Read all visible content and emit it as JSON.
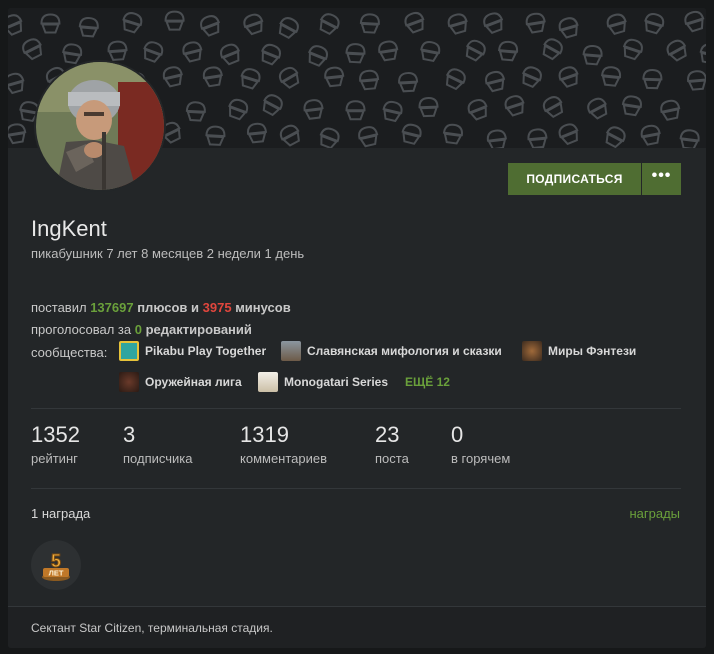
{
  "profile": {
    "username": "IngKent",
    "tenure": "пикабушник 7 лет 8 месяцев 2 недели 1 день",
    "subscribe_label": "ПОДПИСАТЬСЯ",
    "more_label": "•••"
  },
  "votes": {
    "prefix": "поставил",
    "plus_count": "137697",
    "plus_text": "плюсов и",
    "minus_count": "3975",
    "minus_text": "минусов"
  },
  "edits": {
    "prefix": "проголосовал за",
    "count": "0",
    "suffix": "редактирований"
  },
  "communities": {
    "label": "сообщества:",
    "items": [
      {
        "name": "Pikabu Play Together",
        "icon": "game-icon"
      },
      {
        "name": "Славянская мифология и сказки",
        "icon": "mythology-icon"
      },
      {
        "name": "Миры Фэнтези",
        "icon": "fantasy-icon"
      },
      {
        "name": "Оружейная лига",
        "icon": "weapons-icon"
      },
      {
        "name": "Monogatari Series",
        "icon": "anime-icon"
      }
    ],
    "more_label": "ЕЩЁ 12"
  },
  "stats": [
    {
      "value": "1352",
      "label": "рейтинг"
    },
    {
      "value": "3",
      "label": "подписчика"
    },
    {
      "value": "1319",
      "label": "комментариев"
    },
    {
      "value": "23",
      "label": "поста"
    },
    {
      "value": "0",
      "label": "в горячем"
    }
  ],
  "awards": {
    "count_label": "1 награда",
    "link_label": "награды",
    "badge_text": "5",
    "badge_sub": "ЛЕТ"
  },
  "bio": "Сектант Star Citizen, терминальная стадия.",
  "colors": {
    "accent_green": "#6aa03b",
    "button_green": "#4f6d32",
    "minus_red": "#e0463d",
    "card_bg": "#232628"
  }
}
